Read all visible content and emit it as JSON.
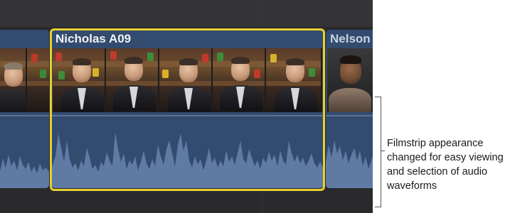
{
  "timeline": {
    "clips": [
      {
        "id": "left",
        "title": ""
      },
      {
        "id": "main",
        "title": "Nicholas A09",
        "selected": true
      },
      {
        "id": "right",
        "title": "Nelson"
      }
    ]
  },
  "callout": {
    "text": "Filmstrip appearance changed for easy viewing and selection of audio waveforms"
  },
  "colors": {
    "timeline_bg": "#2a2a2c",
    "clip_bg": "#324b6f",
    "waveform": "#6a85ad",
    "selection": "#e7d030"
  },
  "icons": {
    "bracket": "right-bracket-icon"
  }
}
